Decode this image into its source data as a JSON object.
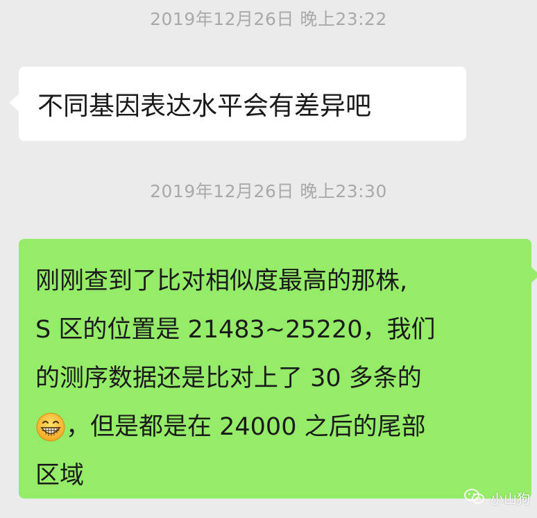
{
  "chat": {
    "messages": [
      {
        "timestamp": "2019年12月26日 晚上23:22",
        "side": "left",
        "text": "不同基因表达水平会有差异吧"
      },
      {
        "timestamp": "2019年12月26日 晚上23:30",
        "side": "right",
        "lines": [
          "刚刚查到了比对相似度最高的那株,",
          "S 区的位置是 21483~25220，我们",
          "的测序数据还是比对上了 30 多条的",
          "，但是都是在 24000 之后的尾部",
          "区域"
        ],
        "emoji": "grinning-face-emoji"
      }
    ]
  },
  "watermark": {
    "text": "小山狗",
    "icon": "wechat-icon"
  },
  "colors": {
    "background": "#ebebeb",
    "incoming_bubble": "#ffffff",
    "outgoing_bubble": "#95ec69",
    "timestamp": "#a9a9a9"
  }
}
